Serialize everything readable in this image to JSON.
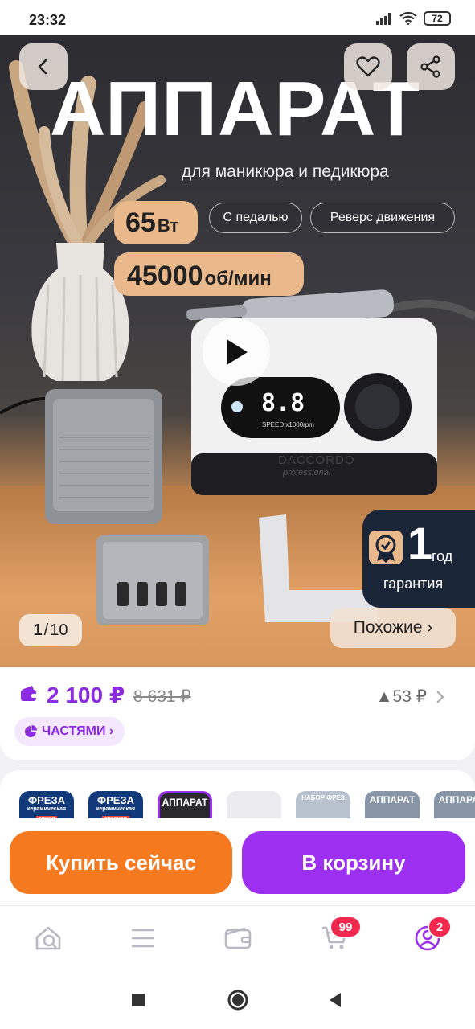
{
  "status_bar": {
    "time": "23:32",
    "battery": "72"
  },
  "hero": {
    "title": "АППАРАТ",
    "subtitle": "для маникюра и педикюра",
    "power_value": "65",
    "power_unit": "Вт",
    "speed_value": "45000",
    "speed_unit": "об/мин",
    "feature_1": "С педалью",
    "feature_2": "Реверс движения",
    "device_brand": "DACCORDO",
    "device_line": "professional",
    "device_display": "8.8",
    "device_speed_label": "SPEED:x1000rpm",
    "warranty_number": "1",
    "warranty_unit": "год",
    "warranty_label": "гарантия",
    "counter_current": "1",
    "counter_total": "10",
    "similar_label": "Похожие ›"
  },
  "price": {
    "current": "2 100 ₽",
    "old": "8 631 ₽",
    "diff": "▲53 ₽",
    "installments_label": "ЧАСТЯМИ ›"
  },
  "thumbnails": [
    {
      "title": "ФРЕЗА",
      "subtitle": "керамическая",
      "tag": "синяя",
      "bg": "#123a7a"
    },
    {
      "title": "ФРЕЗА",
      "subtitle": "керамическая",
      "tag": "красная",
      "bg": "#123a7a"
    },
    {
      "title": "АППАРАТ",
      "subtitle": "",
      "tag": "",
      "bg": "#2a2a2e"
    },
    {
      "title": "",
      "subtitle": "",
      "tag": "",
      "bg": "#e6e6ea"
    },
    {
      "title": "НАБОР ФРЕЗ",
      "subtitle": "",
      "tag": "",
      "bg": "#b9c3cf"
    },
    {
      "title": "АППАРАТ",
      "subtitle": "",
      "tag": "",
      "bg": "#8795a6"
    },
    {
      "title": "АППАРАТ",
      "subtitle": "",
      "tag": "",
      "bg": "#8795a6"
    }
  ],
  "actions": {
    "buy_now": "Купить сейчас",
    "add_to_cart": "В корзину"
  },
  "bottom_nav": {
    "cart_badge": "99",
    "profile_badge": "2"
  },
  "colors": {
    "accent_purple": "#9c2ff0",
    "accent_orange": "#f5791f",
    "badge_red": "#f2284f"
  }
}
